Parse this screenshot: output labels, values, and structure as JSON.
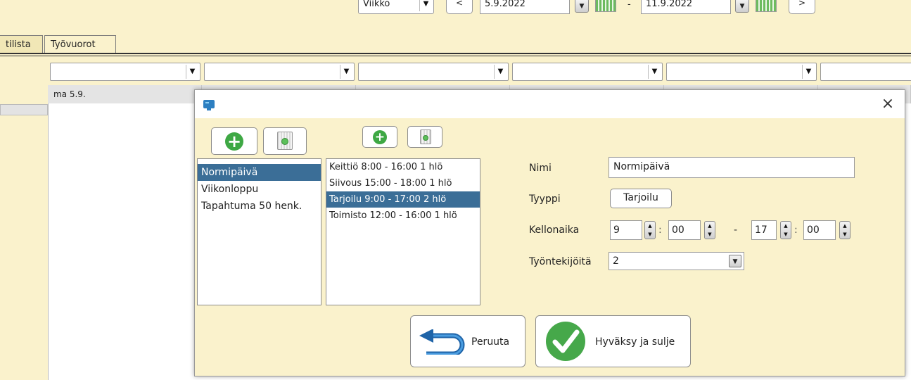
{
  "toolbar": {
    "period_value": "Viikko",
    "prev_label": "<",
    "start_date": "5.9.2022",
    "date_separator": "-",
    "end_date": "11.9.2022",
    "next_label": ">"
  },
  "tabs": [
    {
      "label": "tilista"
    },
    {
      "label": "Työvuorot"
    }
  ],
  "schedule": {
    "first_day": "ma 5.9."
  },
  "dialog": {
    "close_glyph": "×",
    "templates": [
      {
        "label": "Normipäivä",
        "selected": true
      },
      {
        "label": "Viikonloppu",
        "selected": false
      },
      {
        "label": "Tapahtuma 50 henk.",
        "selected": false
      }
    ],
    "shifts": [
      {
        "label": "Keittiö 8:00 - 16:00 1 hlö",
        "selected": false
      },
      {
        "label": "Siivous 15:00 - 18:00 1 hlö",
        "selected": false
      },
      {
        "label": "Tarjoilu 9:00 - 17:00 2 hlö",
        "selected": true
      },
      {
        "label": "Toimisto 12:00 - 16:00 1 hlö",
        "selected": false
      }
    ],
    "form": {
      "name_label": "Nimi",
      "name_value": "Normipäivä",
      "type_label": "Tyyppi",
      "type_value": "Tarjoilu",
      "time_label": "Kellonaika",
      "start_hour": "9",
      "start_min": "00",
      "end_hour": "17",
      "end_min": "00",
      "time_sep": ":",
      "range_sep": "-",
      "workers_label": "Työntekijöitä",
      "workers_value": "2"
    },
    "cancel_label": "Peruuta",
    "ok_label": "Hyväksy ja sulje"
  },
  "colors": {
    "background": "#faf2cc",
    "selection": "#3b6e97",
    "add_green": "#3ea844"
  }
}
